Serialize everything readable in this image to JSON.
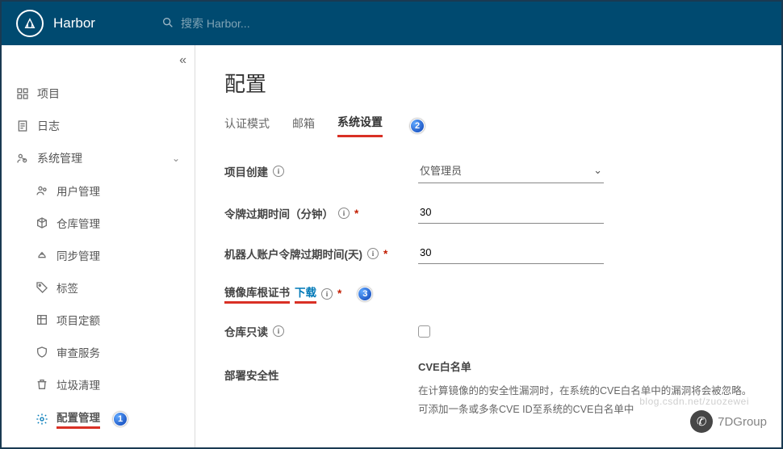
{
  "header": {
    "brand": "Harbor",
    "search_placeholder": "搜索 Harbor..."
  },
  "sidebar": {
    "collapse_icon": "«",
    "items": [
      {
        "label": "项目",
        "icon": "projects"
      },
      {
        "label": "日志",
        "icon": "logs"
      },
      {
        "label": "系统管理",
        "icon": "admin",
        "expandable": true
      }
    ],
    "admin_children": [
      {
        "label": "用户管理",
        "icon": "users"
      },
      {
        "label": "仓库管理",
        "icon": "repo"
      },
      {
        "label": "同步管理",
        "icon": "replication"
      },
      {
        "label": "标签",
        "icon": "tag"
      },
      {
        "label": "项目定额",
        "icon": "quota"
      },
      {
        "label": "审查服务",
        "icon": "scan"
      },
      {
        "label": "垃圾清理",
        "icon": "gc"
      },
      {
        "label": "配置管理",
        "icon": "config",
        "active": true,
        "badge": "1"
      }
    ]
  },
  "main": {
    "title": "配置",
    "tabs": [
      {
        "label": "认证模式"
      },
      {
        "label": "邮箱"
      },
      {
        "label": "系统设置",
        "active": true,
        "badge": "2"
      }
    ],
    "fields": {
      "project_creation": {
        "label": "项目创建",
        "value": "仅管理员"
      },
      "token_expiration": {
        "label": "令牌过期时间（分钟）",
        "value": "30"
      },
      "robot_expiration": {
        "label": "机器人账户令牌过期时间(天)",
        "value": "30"
      },
      "root_cert": {
        "label": "镜像库根证书",
        "link": "下载",
        "badge": "3"
      },
      "readonly": {
        "label": "仓库只读"
      },
      "deploy_security": {
        "label": "部署安全性"
      }
    },
    "cve": {
      "title": "CVE白名单",
      "line1": "在计算镜像的的安全性漏洞时，在系统的CVE白名单中的漏洞将会被忽略。",
      "line2": "可添加一条或多条CVE ID至系统的CVE白名单中"
    }
  },
  "watermark": {
    "text": "7DGroup",
    "url": "blog.csdn.net/zuozewei"
  }
}
